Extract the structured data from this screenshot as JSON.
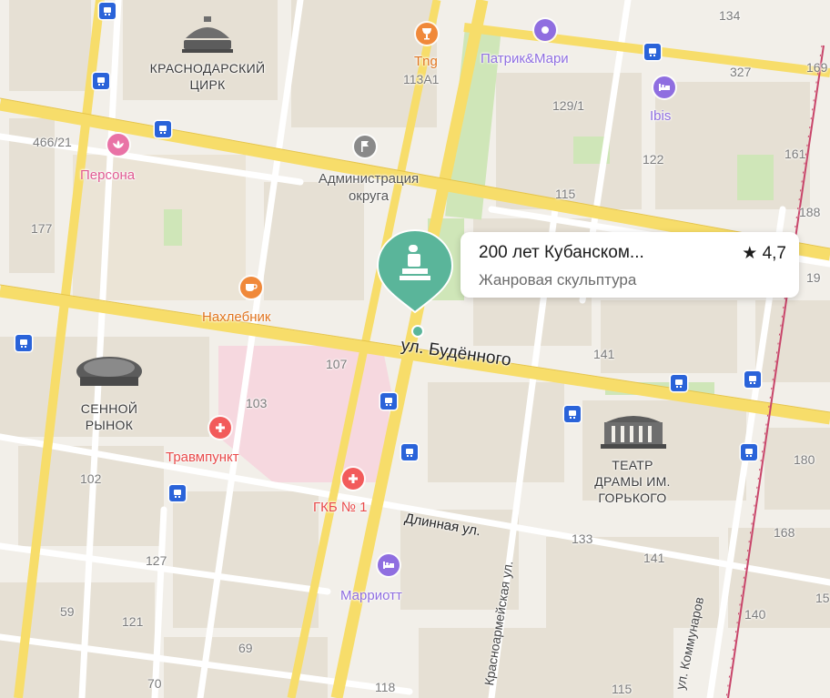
{
  "colors": {
    "background": "#f2efe9",
    "major_road": "#f7dd6a",
    "minor_road": "#ffffff",
    "block": "#e6e0d4",
    "park": "#cfe6b8",
    "hospital": "#f6d8df",
    "rail": "#c8456a",
    "selected_pin": "#5ab59a",
    "food": "#f0893a",
    "medical": "#f25b5b",
    "hotel": "#8f6ee0",
    "shop": "#e973a6",
    "transit": "#2a63d9"
  },
  "selected_place": {
    "name": "200 лет Кубанском...",
    "category": "Жанровая скульптура",
    "rating": "4,7",
    "icon": "sculpture-icon"
  },
  "landmarks": [
    {
      "id": "circus",
      "line1": "КРАСНОДАРСКИЙ",
      "line2": "ЦИРК",
      "icon": "circus-icon"
    },
    {
      "id": "market",
      "line1": "СЕННОЙ",
      "line2": "РЫНОК",
      "icon": "dome-icon"
    },
    {
      "id": "theatre",
      "line1": "ТЕАТР",
      "line2": "ДРАМЫ ИМ.",
      "line3": "ГОРЬКОГО",
      "icon": "theatre-icon"
    }
  ],
  "pois": [
    {
      "id": "tng",
      "name": "Tng",
      "sub": "113А1",
      "icon": "wine-icon"
    },
    {
      "id": "patrik",
      "name": "Патрик&Мари",
      "icon": "dot-icon"
    },
    {
      "id": "ibis",
      "name": "Ibis",
      "icon": "bed-icon"
    },
    {
      "id": "persona",
      "name": "Персона",
      "icon": "lotus-icon"
    },
    {
      "id": "admin",
      "name": "Администрация",
      "name2": "округа",
      "icon": "flag-icon"
    },
    {
      "id": "nakhlebnik",
      "name": "Нахлебник",
      "icon": "cup-icon"
    },
    {
      "id": "travm",
      "name": "Травмпункт",
      "icon": "cross-icon"
    },
    {
      "id": "gkb",
      "name": "ГКБ № 1",
      "icon": "cross-icon"
    },
    {
      "id": "marriott",
      "name": "Марриотт",
      "icon": "bed-icon"
    }
  ],
  "streets": [
    {
      "id": "budennogo",
      "name": "ул. Будённого"
    },
    {
      "id": "dlinnaya",
      "name": "Длинная ул."
    },
    {
      "id": "krasnoarm",
      "name": "Красноармейская ул."
    },
    {
      "id": "kommunarov",
      "name": "ул. Коммунаров"
    }
  ],
  "house_numbers": [
    "134",
    "327",
    "169",
    "129/1",
    "161",
    "122",
    "466/21",
    "115",
    "188",
    "177",
    "19",
    "141",
    "107",
    "103",
    "180",
    "102",
    "133",
    "168",
    "127",
    "141",
    "15",
    "59",
    "121",
    "140",
    "69",
    "70",
    "118",
    "115"
  ]
}
